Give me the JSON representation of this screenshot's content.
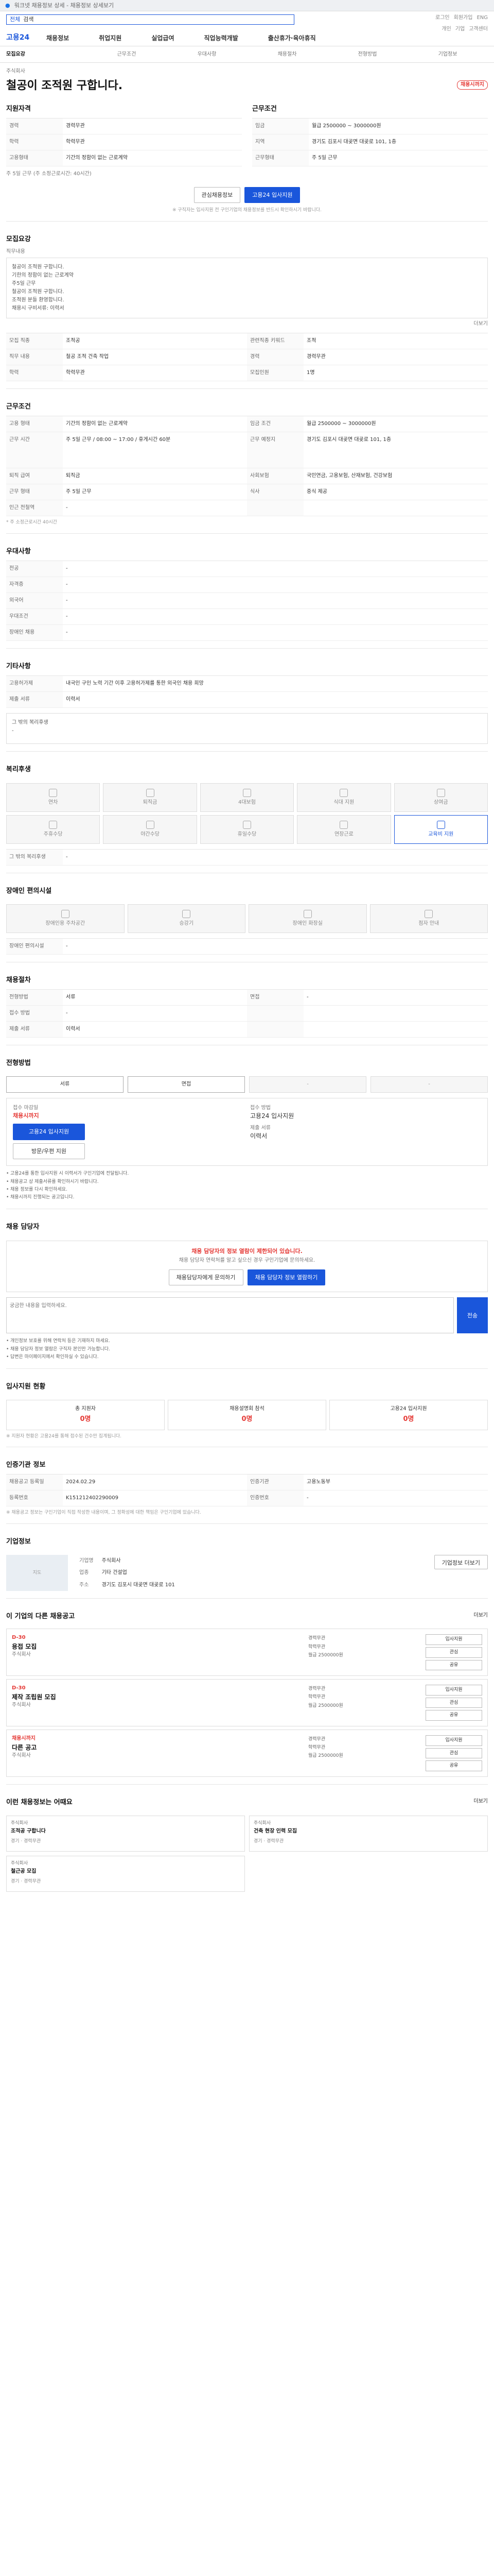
{
  "browser": {
    "tab": "워크넷 채용정보 상세 - 채용정보 상세보기",
    "url": "워크넷"
  },
  "header": {
    "search_select": "전체",
    "search_placeholder": "검색",
    "links_top": [
      "로그인",
      "회원가입",
      "ENG"
    ],
    "links_sub": [
      "개인",
      "기업",
      "고객센터"
    ],
    "logo": "고용24",
    "gnb": [
      "채용정보",
      "취업지원",
      "실업급여",
      "직업능력개발",
      "출산휴가·육아휴직"
    ]
  },
  "subtabs": [
    "모집요강",
    "근무조건",
    "우대사항",
    "채용절차",
    "전형방법",
    "기업정보"
  ],
  "job": {
    "company": "주식회사",
    "status": "채용시까지",
    "title": "철공이 조적원 구합니다.",
    "period_label": "접수기간",
    "close": "채용시까지",
    "registered": "등록일 2024-02-29"
  },
  "summary": {
    "left_title": "지원자격",
    "right_title": "근무조건",
    "rows": [
      {
        "k": "경력",
        "v": "경력무관"
      },
      {
        "k": "임금",
        "v": "월급 2500000 ~ 3000000원"
      },
      {
        "k": "학력",
        "v": "학력무관"
      },
      {
        "k": "지역",
        "v": "경기도 김포시 대곶면 대곶로 101, 1층"
      },
      {
        "k": "고용형태",
        "v": "기간의 정함이 없는 근로계약"
      },
      {
        "k": "근무형태",
        "v": "주 5일 근무"
      },
      {
        "k": "근무시간",
        "v": "주 5일 근무 (주 소정근로시간: 40시간)"
      }
    ],
    "btn_scrap": "관심채용정보",
    "btn_apply": "고용24 입사지원",
    "footnote": "※ 구직자는 입사지원 전 구인기업의 채용정보를 반드시 확인하시기 바랍니다."
  },
  "recruit": {
    "title": "모집요강",
    "desc_label": "직무내용",
    "desc": "철공이 조적원 구합니다.\n기한의 정함이 없는 근로계약\n주5일 근무\n철공이 조적원 구합니다.\n조적원 분들 환영합니다.\n채용시 구비서류: 이력서\n",
    "summary_link": "더보기",
    "rows": [
      {
        "k": "모집 직종",
        "v": "조적공",
        "k2": "관련직종 키워드",
        "v2": "조적"
      },
      {
        "k": "직무 내용",
        "v": "철공 조적 건축 작업",
        "k2": "경력",
        "v2": "경력무관"
      },
      {
        "k": "학력",
        "v": "학력무관",
        "k2": "모집인원",
        "v2": "1명"
      }
    ]
  },
  "conditions": {
    "title": "근무조건",
    "rows": [
      {
        "k": "고용 형태",
        "v": "기간의 정함이 없는 근로계약",
        "k2": "임금 조건",
        "v2": "월급 2500000 ~ 3000000원"
      },
      {
        "k": "근무 시간",
        "v": "주 5일 근무 / 08:00 ~ 17:00 / 휴게시간 60분",
        "k2": "근무 예정지",
        "v2": "경기도 김포시 대곶면 대곶로 101, 1층"
      },
      {
        "k": "퇴직 급여",
        "v": "퇴직금",
        "k2": "사회보험",
        "v2": "국민연금, 고용보험, 산재보험, 건강보험"
      },
      {
        "k": "근무 형태",
        "v": "주 5일 근무",
        "k2": "식사",
        "v2": "중식 제공"
      },
      {
        "k": "인근 전철역",
        "v": "-",
        "k2": "",
        "v2": ""
      }
    ],
    "note": "* 주 소정근로시간 40시간"
  },
  "preferred": {
    "title": "우대사항",
    "rows": [
      {
        "k": "전공",
        "v": "-"
      },
      {
        "k": "자격증",
        "v": "-"
      },
      {
        "k": "외국어",
        "v": "-"
      },
      {
        "k": "우대조건",
        "v": "-"
      },
      {
        "k": "장애인 채용",
        "v": "-"
      }
    ]
  },
  "others": {
    "title": "기타사항",
    "rows": [
      {
        "k": "고용허가제",
        "v": "내국인 구인 노력 기간 이후 고용허가제를 통한 외국인 채용 희망"
      },
      {
        "k": "제출 서류",
        "v": "이력서"
      }
    ],
    "textbox": "그 밖의 복리후생\n-"
  },
  "welfare": {
    "title": "복리후생",
    "items": [
      "연차",
      "퇴직금",
      "4대보험",
      "식대 지원",
      "상여금",
      "주휴수당",
      "야간수당",
      "휴일수당",
      "연장근로",
      "교육비 지원"
    ],
    "on_index": 9,
    "link": "그 밖의 복리후생",
    "link_val": "-"
  },
  "disabled": {
    "title": "장애인 편의시설",
    "items": [
      "장애인용 주차공간",
      "승강기",
      "장애인 화장실",
      "점자 안내"
    ],
    "link": "장애인 편의시설",
    "link_val": "-"
  },
  "process": {
    "title": "채용절차",
    "rows": [
      {
        "k": "전형방법",
        "v": "서류",
        "k2": "면접",
        "v2": "-"
      },
      {
        "k": "접수 방법",
        "v": "-",
        "k2": "",
        "v2": ""
      },
      {
        "k": "제출 서류",
        "v": "이력서",
        "k2": "",
        "v2": ""
      }
    ],
    "steps": [
      "서류",
      "면접",
      "-",
      "-"
    ]
  },
  "apply": {
    "title": "전형방법",
    "deadline_label": "접수 마감일",
    "deadline": "채용시까지",
    "btn_apply": "고용24 입사지원",
    "btn_email": "방문/우편 지원",
    "method_label": "접수 방법",
    "method": "고용24 입사지원",
    "doc_label": "제출 서류",
    "doc": "이력서",
    "notes": [
      "고용24를 통한 입사지원 시 이력서가 구인기업에 전달됩니다.",
      "채용공고 상 제출서류를 확인하시기 바랍니다.",
      "채용 정보를 다시 확인하세요.",
      "채용시까지 진행되는 공고입니다."
    ]
  },
  "manager": {
    "title": "채용 담당자",
    "alert": "채용 담당자의 정보 열람이 제한되어 있습니다.",
    "alert_sub": "채용 담당자 연락처를 알고 싶으신 경우 구인기업에 문의하세요.",
    "btn1": "채용담당자에게 문의하기",
    "btn2": "채용 담당자 정보 열람하기",
    "q_placeholder": "궁금한 내용을 입력하세요.",
    "q_btn": "전송",
    "notes": [
      "개인정보 보호를 위해 연락처 등은 기재하지 마세요.",
      "채용 담당자 정보 열람은 구직자 본인만 가능합니다.",
      "답변은 마이페이지에서 확인하실 수 있습니다."
    ]
  },
  "stats": {
    "title": "입사지원 현황",
    "items": [
      {
        "label": "총 지원자",
        "value": "0명"
      },
      {
        "label": "채용설명회 참석",
        "value": "0명"
      },
      {
        "label": "고용24 입사지원",
        "value": "0명"
      }
    ],
    "note": "※ 지원자 현황은 고용24를 통해 접수된 건수만 집계됩니다."
  },
  "meta": {
    "title": "인증기관 정보",
    "rows": [
      {
        "k": "채용공고 등록일",
        "v": "2024.02.29",
        "k2": "인증기관",
        "v2": "고용노동부"
      },
      {
        "k": "등록번호",
        "v": "K151212402290009",
        "k2": "인증번호",
        "v2": "-"
      }
    ],
    "note": "※ 채용공고 정보는 구인기업이 직접 작성한 내용이며, 그 정확성에 대한 책임은 구인기업에 있습니다."
  },
  "company": {
    "title": "기업정보",
    "map": "지도",
    "rows": [
      {
        "k": "기업명",
        "v": "주식회사"
      },
      {
        "k": "업종",
        "v": "기타 건설업"
      },
      {
        "k": "주소",
        "v": "경기도 김포시 대곶면 대곶로 101"
      }
    ],
    "btn": "기업정보 더보기"
  },
  "jobs": {
    "title": "이 기업의 다른 채용공고",
    "more": "더보기",
    "items": [
      {
        "d": "D-30",
        "title": "용접 모집",
        "company": "주식회사",
        "r": [
          "경력무관",
          "학력무관",
          "월급 2500000원"
        ]
      },
      {
        "d": "D-30",
        "title": "제작 조립원 모집",
        "company": "주식회사",
        "r": [
          "경력무관",
          "학력무관",
          "월급 2500000원"
        ]
      },
      {
        "d": "채용시까지",
        "title": "다른 공고",
        "company": "주식회사",
        "r": [
          "경력무관",
          "학력무관",
          "월급 2500000원"
        ]
      }
    ],
    "act": [
      "입사지원",
      "관심",
      "공유"
    ]
  },
  "recommend": {
    "title": "이런 채용정보는 어때요",
    "more": "더보기",
    "items": [
      {
        "co": "주식회사",
        "t": "조적공 구합니다",
        "m": "경기 · 경력무관"
      },
      {
        "co": "주식회사",
        "t": "건축 현장 인력 모집",
        "m": "경기 · 경력무관"
      },
      {
        "co": "주식회사",
        "t": "철근공 모집",
        "m": "경기 · 경력무관"
      }
    ]
  }
}
